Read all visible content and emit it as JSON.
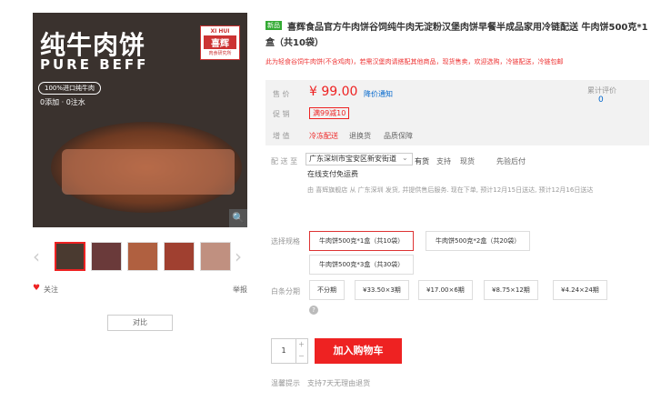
{
  "main_image": {
    "title": "纯牛肉饼",
    "subtitle": "PURE BEFF",
    "pill": "100%进口纯牛肉",
    "features": "0添加 · 0注水",
    "logo_en": "XI HUI",
    "logo_cn": "喜辉",
    "logo_label": "肉食研究所"
  },
  "product": {
    "badge": "新品",
    "title": "喜辉食品官方牛肉饼谷饲纯牛肉无淀粉汉堡肉饼早餐半成品家用冷链配送 牛肉饼500克*1盒（共10袋）",
    "promo": "此为轻食谷饲牛肉饼(不含鸡肉)，若需汉堡肉请搭配其他商品，现货售卖，欢迎选购，冷链配送，冷链包邮"
  },
  "price": {
    "label": "售 价",
    "value": "¥ 99.00",
    "notify": "降价通知",
    "review_label": "累计评价",
    "review_count": "0"
  },
  "promotion": {
    "label": "促 销",
    "tag": "满99减10"
  },
  "service": {
    "label": "增 值",
    "items": [
      "冷冻配送",
      "退换货",
      "品质保障"
    ]
  },
  "delivery": {
    "label": "配 送 至",
    "address": "广东深圳市宝安区新安街道",
    "stock": "有货",
    "notes": [
      "支持",
      "现货",
      "先验后付"
    ],
    "online_pay": "在线支付免运费",
    "dispatch_note": "由 喜辉旗舰店 从 广东深圳 发货, 并提供售后服务. 现在下单, 预计12月15日送达, 预计12月16日送达"
  },
  "selection": {
    "label": "选择规格",
    "variants": [
      "牛肉饼500克*1盒（共10袋）",
      "牛肉饼500克*2盒（共20袋）",
      "牛肉饼500克*3盒（共30袋）"
    ]
  },
  "installment": {
    "label": "白条分期",
    "plans": [
      "不分期",
      "¥33.50×3期",
      "¥17.00×6期",
      "¥8.75×12期",
      "¥4.24×24期"
    ]
  },
  "actions": {
    "favorite": "关注",
    "report": "举报",
    "compare": "对比",
    "add_cart": "加入购物车",
    "quantity": "1"
  },
  "shipping": {
    "label": "温馨提示",
    "text": "支持7天无理由退货"
  }
}
